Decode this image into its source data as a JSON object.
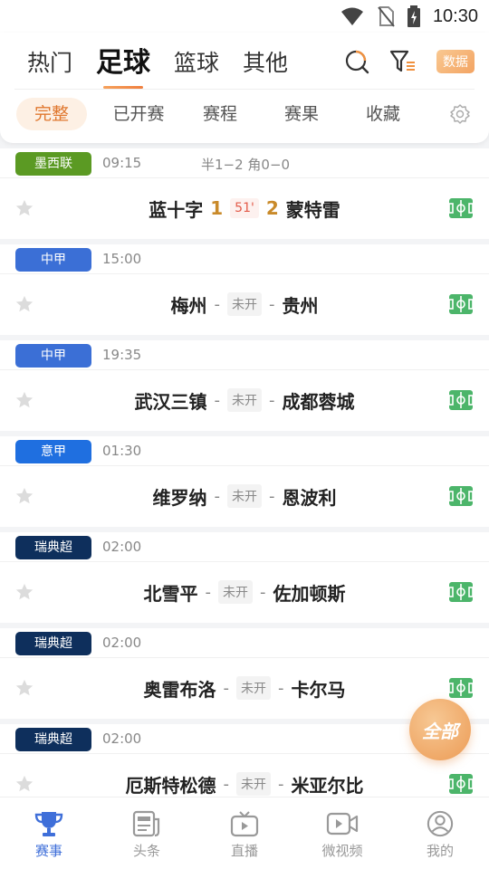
{
  "status_bar": {
    "time": "10:30"
  },
  "sport_tabs": [
    {
      "label": "热门"
    },
    {
      "label": "足球",
      "active": true
    },
    {
      "label": "篮球"
    },
    {
      "label": "其他"
    }
  ],
  "header": {
    "data_button": "数据"
  },
  "sub_tabs": [
    {
      "label": "完整",
      "active": true
    },
    {
      "label": "已开赛"
    },
    {
      "label": "赛程"
    },
    {
      "label": "赛果"
    },
    {
      "label": "收藏"
    }
  ],
  "matches": [
    {
      "league": "墨西联",
      "league_color": "#5b9a23",
      "time": "09:15",
      "note": "半1−2 角0−0",
      "home": "蓝十字",
      "away": "蒙特雷",
      "home_score": "1",
      "away_score": "2",
      "status": "51'",
      "live": true
    },
    {
      "league": "中甲",
      "league_color": "#3b6fd6",
      "time": "15:00",
      "note": "",
      "home": "梅州",
      "away": "贵州",
      "status": "未开",
      "live": false
    },
    {
      "league": "中甲",
      "league_color": "#3b6fd6",
      "time": "19:35",
      "note": "",
      "home": "武汉三镇",
      "away": "成都蓉城",
      "status": "未开",
      "live": false
    },
    {
      "league": "意甲",
      "league_color": "#1f6fe0",
      "time": "01:30",
      "note": "",
      "home": "维罗纳",
      "away": "恩波利",
      "status": "未开",
      "live": false
    },
    {
      "league": "瑞典超",
      "league_color": "#0e2f5c",
      "time": "02:00",
      "note": "",
      "home": "北雪平",
      "away": "佐加顿斯",
      "status": "未开",
      "live": false
    },
    {
      "league": "瑞典超",
      "league_color": "#0e2f5c",
      "time": "02:00",
      "note": "",
      "home": "奥雷布洛",
      "away": "卡尔马",
      "status": "未开",
      "live": false
    },
    {
      "league": "瑞典超",
      "league_color": "#0e2f5c",
      "time": "02:00",
      "note": "",
      "home": "厄斯特松德",
      "away": "米亚尔比",
      "status": "未开",
      "live": false
    }
  ],
  "fab": {
    "label": "全部"
  },
  "bottom_nav": [
    {
      "label": "赛事",
      "icon": "trophy-icon",
      "active": true
    },
    {
      "label": "头条",
      "icon": "news-icon"
    },
    {
      "label": "直播",
      "icon": "tv-icon"
    },
    {
      "label": "微视频",
      "icon": "video-icon"
    },
    {
      "label": "我的",
      "icon": "profile-icon"
    }
  ],
  "colors": {
    "accent": "#e0782f",
    "nav_active": "#3f6fd9",
    "score": "#c98a2a",
    "live": "#e35b4a",
    "field": "#4cb56a"
  }
}
